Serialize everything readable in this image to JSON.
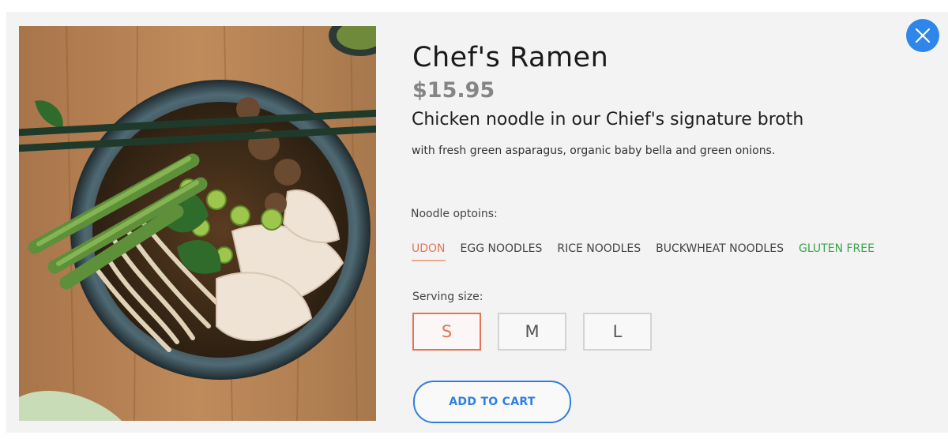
{
  "product": {
    "title": "Chef's Ramen",
    "price": "$15.95",
    "subtitle": "Chicken noodle in our Chief's signature broth",
    "description": "with fresh green asparagus, organic baby bella and green onions.",
    "image_icon": "ramen-bowl-photo"
  },
  "noodle": {
    "label": "Noodle optoins:",
    "options": [
      "UDON",
      "EGG NOODLES",
      "RICE NOODLES",
      "BUCKWHEAT NOODLES",
      "GLUTEN FREE"
    ],
    "selected": "UDON"
  },
  "serving": {
    "label": "Serving  size:",
    "sizes": [
      "S",
      "M",
      "L"
    ],
    "selected": "S"
  },
  "actions": {
    "add_to_cart": "ADD TO CART",
    "close_icon": "close-icon"
  },
  "colors": {
    "accent_blue": "#2f86ea",
    "selected_orange": "#e17657",
    "gluten_free_green": "#3aa54a",
    "panel_bg": "#f3f3f3"
  }
}
